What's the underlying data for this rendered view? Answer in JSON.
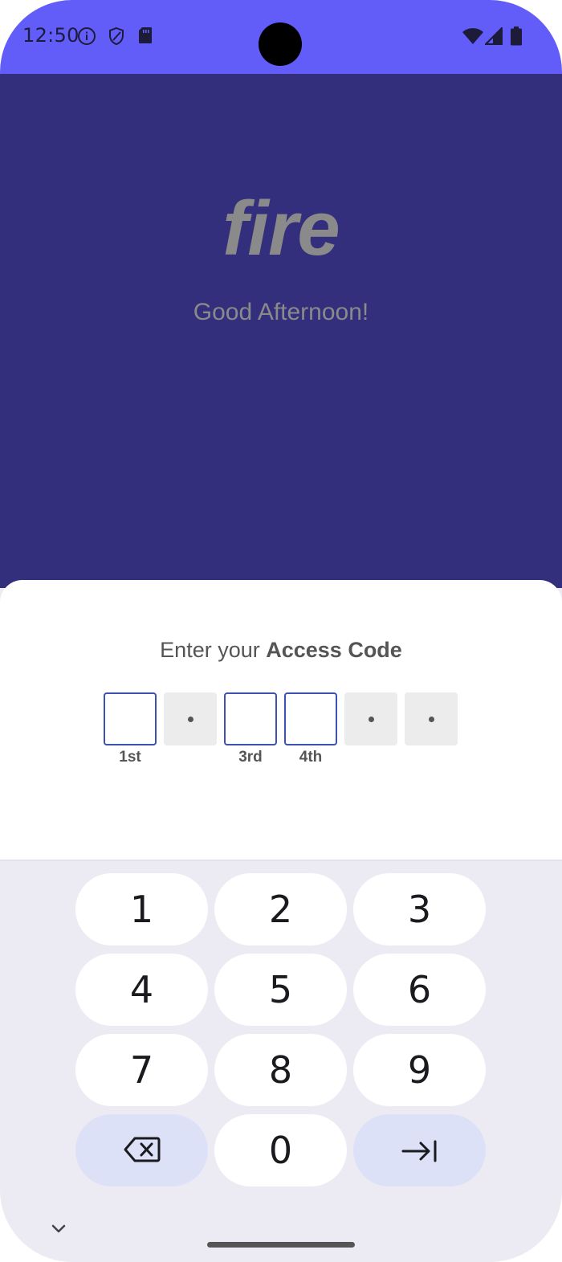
{
  "status_bar": {
    "time": "12:50",
    "icons_left": [
      "info-icon",
      "shield-icon",
      "sd-card-icon"
    ],
    "icons_right": [
      "wifi-icon",
      "signal-icon",
      "battery-icon"
    ]
  },
  "hero": {
    "logo_text": "fire",
    "greeting": "Good Afternoon!"
  },
  "access_code": {
    "title_prefix": "Enter your ",
    "title_bold": "Access Code",
    "boxes": [
      {
        "state": "empty",
        "label": "1st"
      },
      {
        "state": "masked",
        "label": ""
      },
      {
        "state": "empty",
        "label": "3rd"
      },
      {
        "state": "empty",
        "label": "4th"
      },
      {
        "state": "masked",
        "label": ""
      },
      {
        "state": "masked",
        "label": ""
      }
    ]
  },
  "keypad": {
    "keys": [
      "1",
      "2",
      "3",
      "4",
      "5",
      "6",
      "7",
      "8",
      "9"
    ],
    "zero": "0",
    "backspace_icon": "backspace-icon",
    "next_icon": "tab-next-icon",
    "hide_icon": "chevron-down-icon"
  },
  "colors": {
    "status_bar": "#625df9",
    "hero_background": "#342f7c",
    "input_border": "#3d52b0",
    "action_key": "#dde1f8"
  }
}
